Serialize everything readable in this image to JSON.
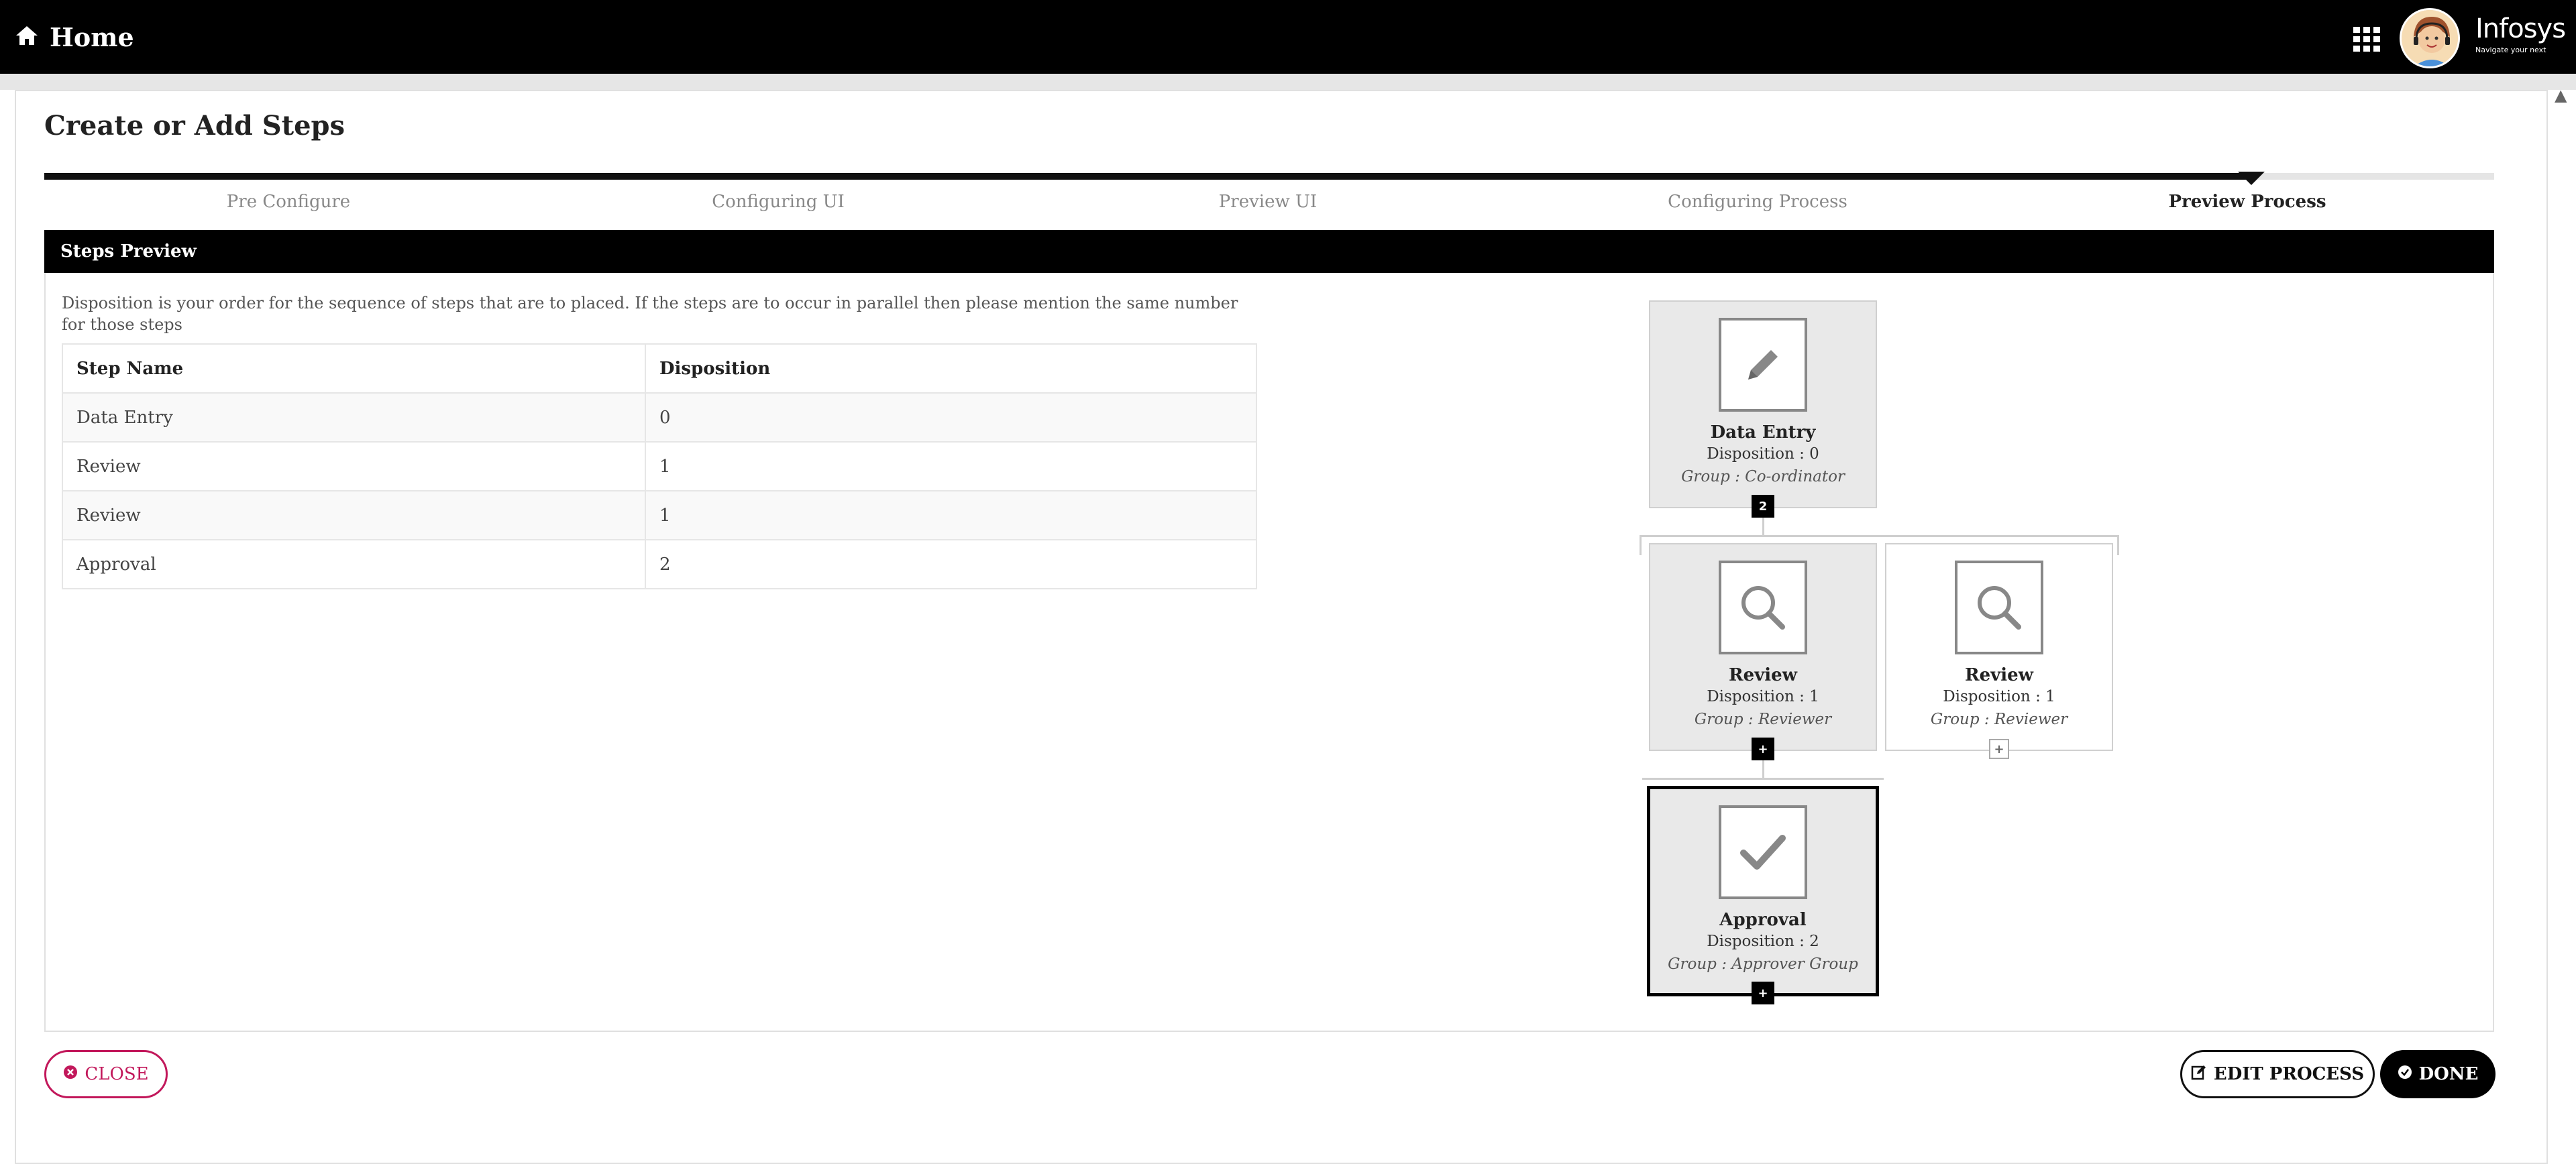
{
  "header": {
    "home_label": "Home",
    "home_icon": "home-icon",
    "apps_icon": "grid-icon",
    "brand_name": "Infosys",
    "brand_tagline": "Navigate your next"
  },
  "page": {
    "title": "Create or Add Steps"
  },
  "wizard": {
    "steps": [
      "Pre Configure",
      "Configuring UI",
      "Preview UI",
      "Configuring Process",
      "Preview Process"
    ],
    "active_index": 4
  },
  "steps_preview": {
    "header": "Steps Preview",
    "note": "Disposition is your order for the sequence of steps that are to placed. If the steps are to occur in parallel then please mention the same number for those steps",
    "table": {
      "columns": [
        "Step Name",
        "Disposition"
      ],
      "rows": [
        [
          "Data Entry",
          "0"
        ],
        [
          "Review",
          "1"
        ],
        [
          "Review",
          "1"
        ],
        [
          "Approval",
          "2"
        ]
      ]
    }
  },
  "flow": {
    "nodes": [
      {
        "title": "Data Entry",
        "disposition": "Disposition : 0",
        "group": "Group : Co-ordinator",
        "icon": "pencil-icon",
        "badge": "2"
      },
      {
        "title": "Review",
        "disposition": "Disposition : 1",
        "group": "Group : Reviewer",
        "icon": "search-icon",
        "badge": "+"
      },
      {
        "title": "Review",
        "disposition": "Disposition : 1",
        "group": "Group : Reviewer",
        "icon": "search-icon",
        "badge": "+"
      },
      {
        "title": "Approval",
        "disposition": "Disposition : 2",
        "group": "Group : Approver Group",
        "icon": "check-icon",
        "badge": "+"
      }
    ]
  },
  "actions": {
    "close": "CLOSE",
    "edit_process": "EDIT PROCESS",
    "done": "DONE"
  },
  "colors": {
    "topbar": "#000000",
    "accent_close": "#c2185b"
  }
}
